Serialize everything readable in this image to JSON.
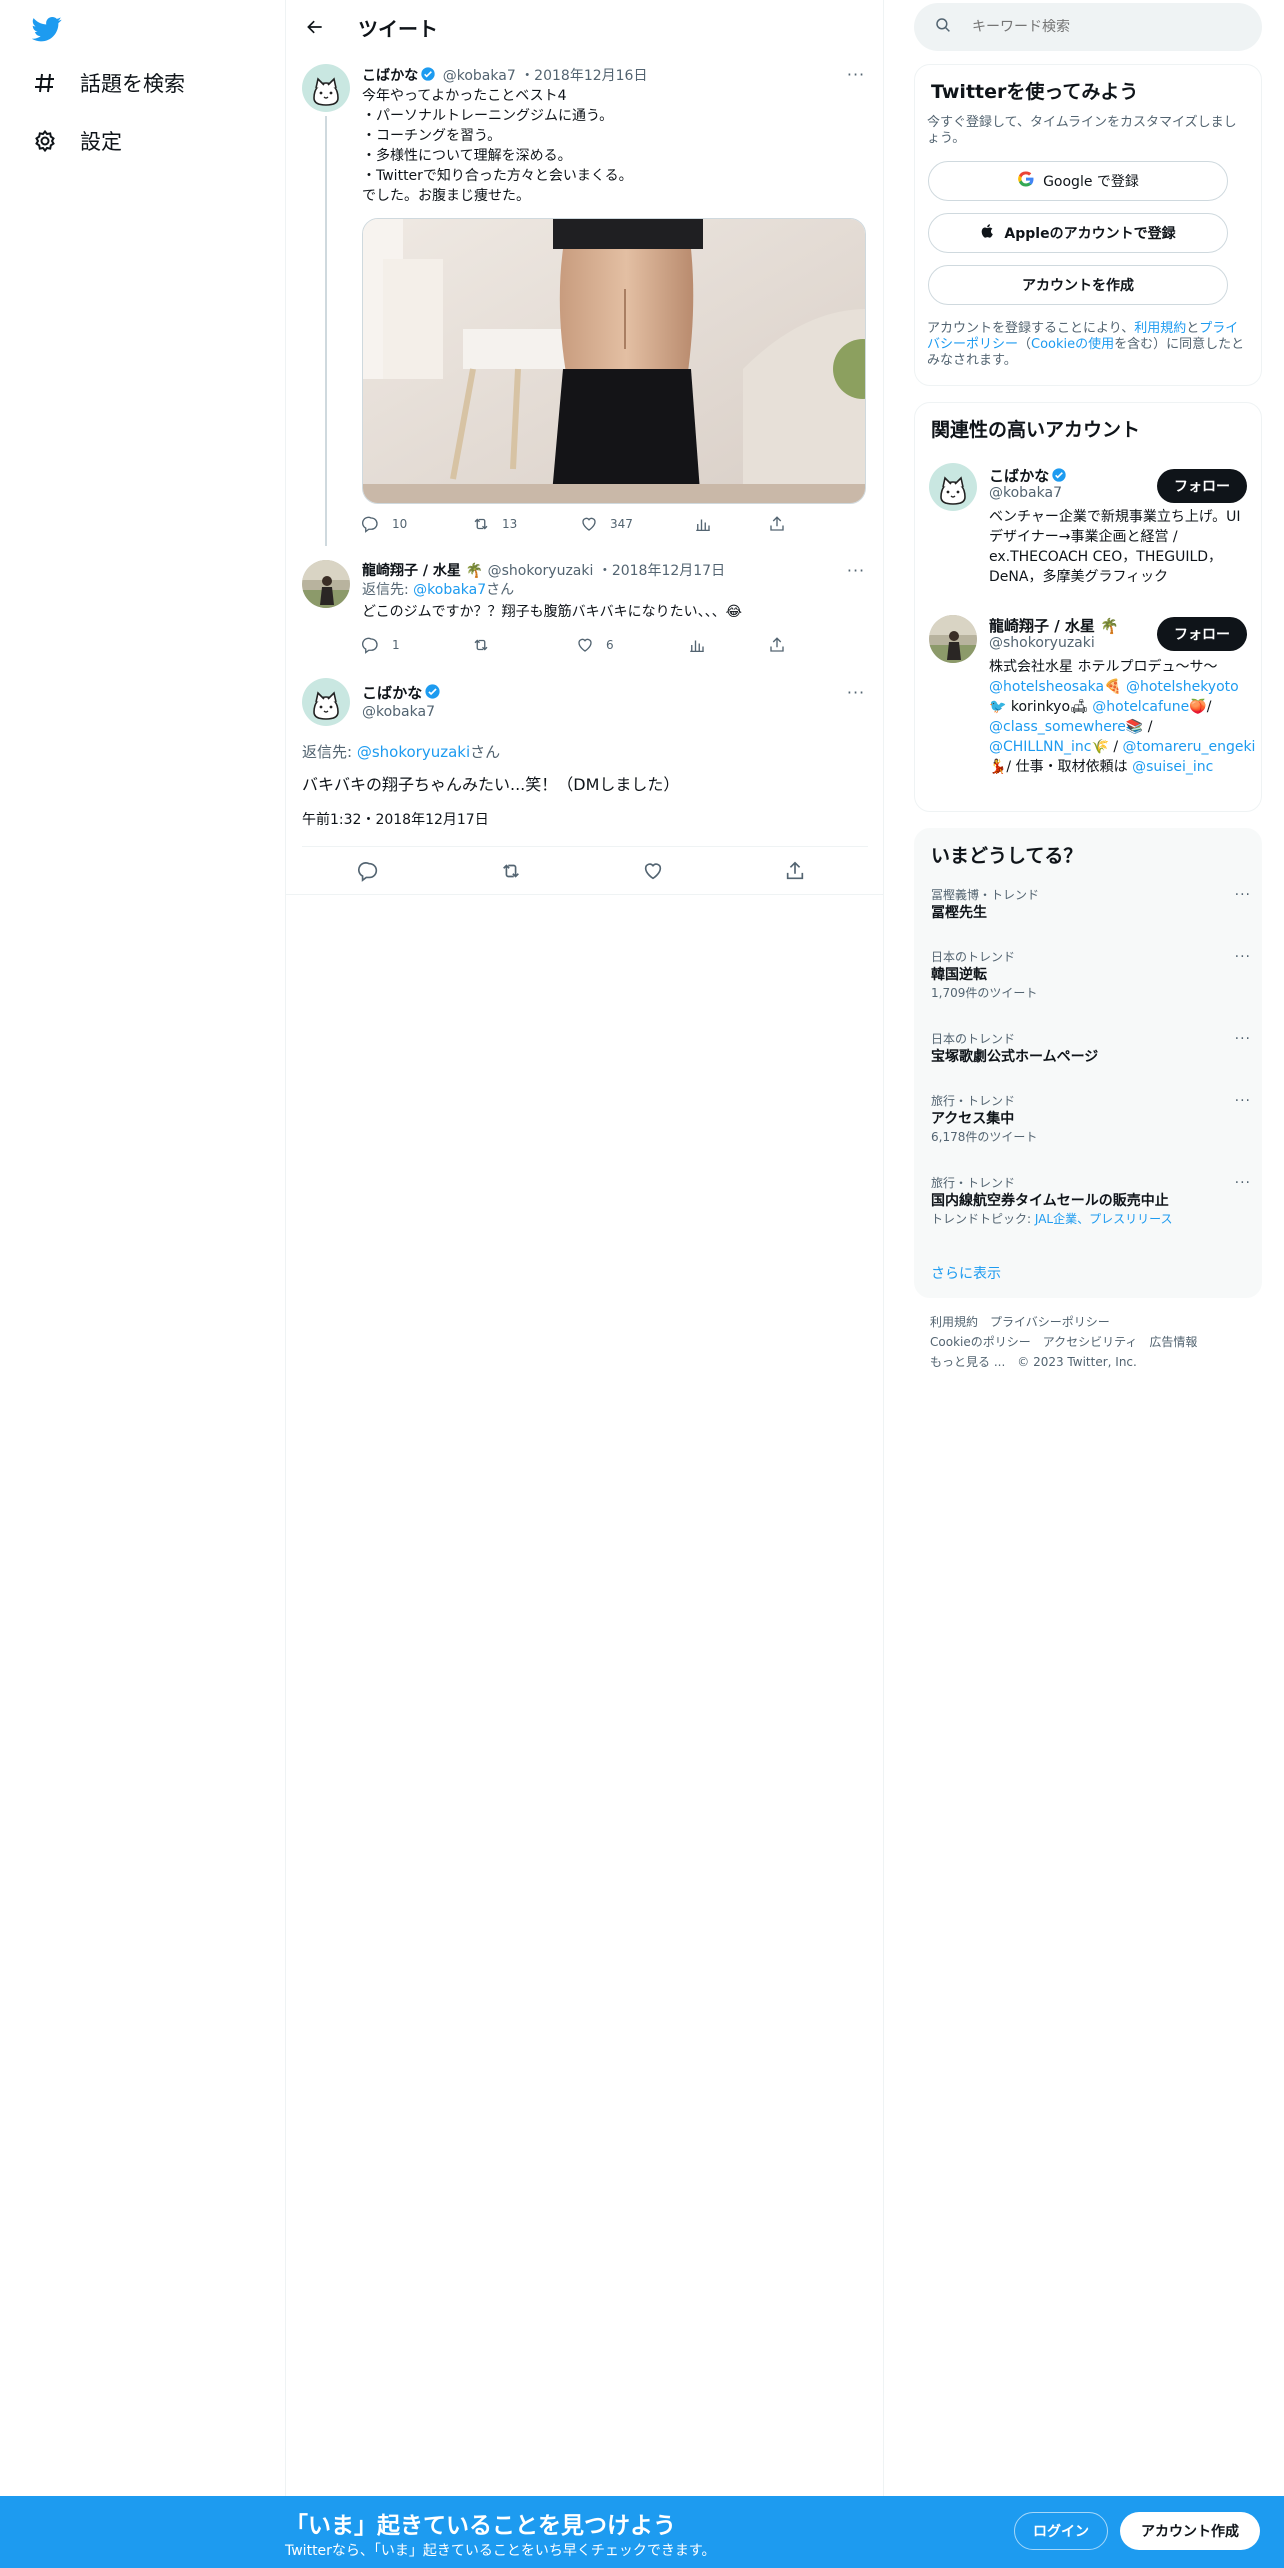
{
  "nav": {
    "items": [
      {
        "label": "話題を検索",
        "icon": "hashtag-icon"
      },
      {
        "label": "設定",
        "icon": "gear-icon"
      }
    ]
  },
  "header": {
    "title": "ツイート"
  },
  "thread": {
    "tweet1": {
      "name": "こばかな",
      "handle": "@kobaka7",
      "date": "・2018年12月16日",
      "text": "今年やってよかったことベスト4\n・パーソナルトレーニングジムに通う。\n・コーチングを習う。\n・多様性について理解を深める。\n・Twitterで知り合った方々と会いまくる。\nでした。お腹まじ痩せた。",
      "replies": "10",
      "retweets": "13",
      "likes": "347"
    },
    "tweet2": {
      "name": "龍崎翔子 / 水星 🌴",
      "handle": "@shokoryuzaki",
      "date": "・2018年12月17日",
      "reply_prefix": "返信先: ",
      "reply_to": "@kobaka7",
      "reply_suffix": "さん",
      "text": "どこのジムですか？？翔子も腹筋バキバキになりたい、、、😂",
      "replies": "1",
      "retweets": "",
      "likes": "6"
    },
    "main_tweet": {
      "name": "こばかな",
      "handle": "@kobaka7",
      "reply_prefix": "返信先: ",
      "reply_to": "@shokoryuzaki",
      "reply_suffix": "さん",
      "text": "バキバキの翔子ちゃんみたい...笑！（DMしました）",
      "timestamp": "午前1:32・2018年12月17日"
    }
  },
  "search": {
    "placeholder": "キーワード検索"
  },
  "signup_card": {
    "title": "Twitterを使ってみよう",
    "subtitle": "今すぐ登録して、タイムラインをカスタマイズしましょう。",
    "google_label": "Google で登録",
    "apple_label": "Appleのアカウントで登録",
    "create_label": "アカウントを作成",
    "legal_1": "アカウントを登録することにより、",
    "legal_terms": "利用規約",
    "legal_2": "と",
    "legal_privacy": "プライバシーポリシー",
    "legal_3": "（",
    "legal_cookie": "Cookieの使用",
    "legal_4": "を含む）に同意したとみなされます。"
  },
  "related": {
    "title": "関連性の高いアカウント",
    "follow_label": "フォロー",
    "accounts": [
      {
        "name": "こばかな",
        "handle": "@kobaka7",
        "bio": "ベンチャー企業で新規事業立ち上げ。UIデザイナー→事業企画と経営 / ex.THECOACH CEO，THEGUILD，DeNA，多摩美グラフィック"
      },
      {
        "name": "龍崎翔子 / 水星 🌴",
        "handle": "@shokoryuzaki",
        "bio_1": "株式会社水星 ホテルプロデュ〜サ〜",
        "link_1": "@hotelsheosaka",
        "bio_2": "🍕 ",
        "link_2": "@hotelshekyoto",
        "bio_3": "🐦 korinkyo🛋 ",
        "link_3": "@hotelcafune",
        "bio_4": "🍑/ ",
        "link_4": "@class_somewhere",
        "bio_5": "📚 / ",
        "link_5": "@CHILLNN_inc",
        "bio_6": "🌾 / ",
        "link_6": "@tomareru_engeki",
        "bio_7": "💃/ 仕事・取材依頼は ",
        "link_7": "@suisei_inc"
      }
    ]
  },
  "trends": {
    "title": "いまどうしてる？",
    "items": [
      {
        "meta": "冨樫義博・トレンド",
        "title": "冨樫先生",
        "sub": ""
      },
      {
        "meta": "日本のトレンド",
        "title": "韓国逆転",
        "sub": "1,709件のツイート"
      },
      {
        "meta": "日本のトレンド",
        "title": "宝塚歌劇公式ホームページ",
        "sub": ""
      },
      {
        "meta": "旅行・トレンド",
        "title": "アクセス集中",
        "sub": "6,178件のツイート"
      },
      {
        "meta": "旅行・トレンド",
        "title": "国内線航空券タイムセールの販売中止",
        "sub_prefix": "トレンドトピック: ",
        "sub_links": "JAL企業、プレスリリース"
      }
    ],
    "show_more": "さらに表示"
  },
  "footer": {
    "links": [
      "利用規約",
      "プライバシーポリシー",
      "Cookieのポリシー",
      "アクセシビリティ",
      "広告情報",
      "もっと見る ...",
      "© 2023 Twitter, Inc."
    ]
  },
  "bottom_bar": {
    "title": "「いま」起きていることを見つけよう",
    "subtitle": "Twitterなら、「いま」起きていることをいち早くチェックできます。",
    "login_label": "ログイン",
    "signup_label": "アカウント作成"
  },
  "colors": {
    "accent": "#1d9bf0",
    "text": "#0f1419",
    "secondary": "#536471",
    "border": "#eff3f4"
  }
}
